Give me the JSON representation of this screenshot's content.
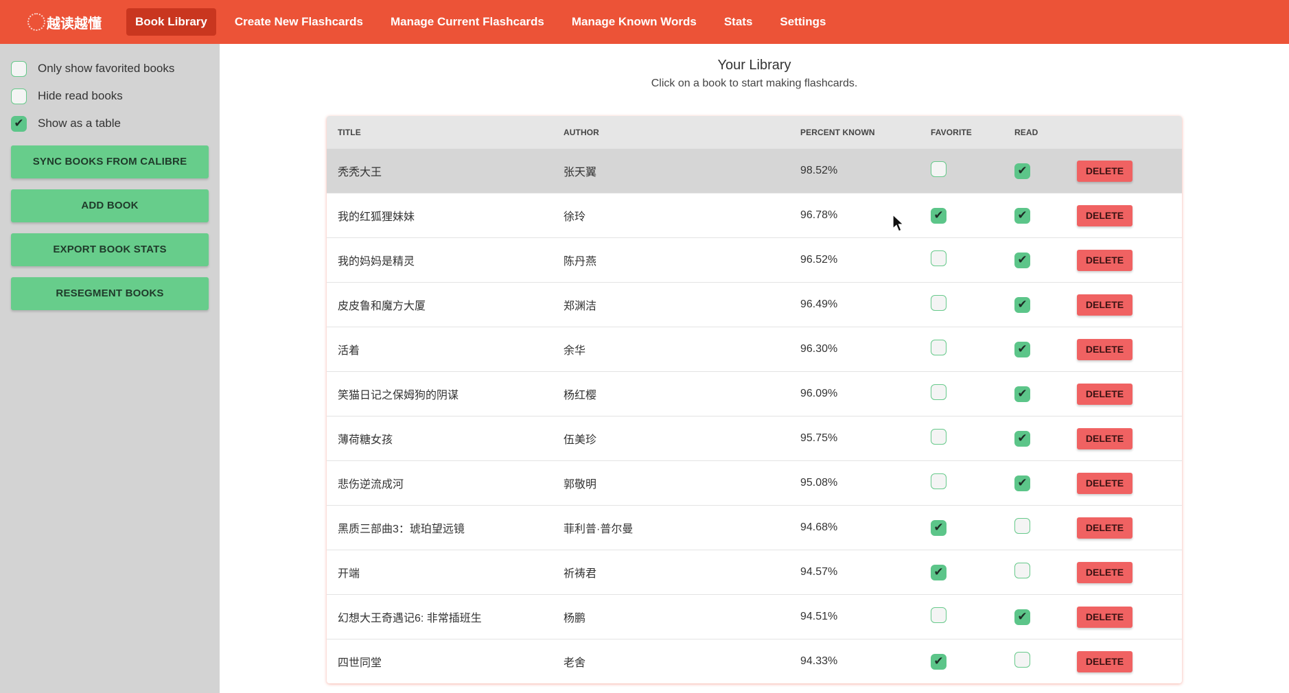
{
  "app": {
    "brand_name": "越读越懂",
    "accent_color": "#ec5337",
    "success_color": "#67cd8b",
    "danger_color": "#f06262"
  },
  "nav": {
    "items": [
      {
        "label": "Book Library",
        "active": true
      },
      {
        "label": "Create New Flashcards",
        "active": false
      },
      {
        "label": "Manage Current Flashcards",
        "active": false
      },
      {
        "label": "Manage Known Words",
        "active": false
      },
      {
        "label": "Stats",
        "active": false
      },
      {
        "label": "Settings",
        "active": false
      }
    ]
  },
  "sidebar": {
    "filters": [
      {
        "label": "Only show favorited books",
        "checked": false
      },
      {
        "label": "Hide read books",
        "checked": false
      },
      {
        "label": "Show as a table",
        "checked": true
      }
    ],
    "buttons": [
      {
        "label": "SYNC BOOKS FROM CALIBRE"
      },
      {
        "label": "ADD BOOK"
      },
      {
        "label": "EXPORT BOOK STATS"
      },
      {
        "label": "RESEGMENT BOOKS"
      }
    ]
  },
  "main": {
    "title": "Your Library",
    "subtitle": "Click on a book to start making flashcards."
  },
  "table": {
    "headers": {
      "title": "TITLE",
      "author": "AUTHOR",
      "percent_known": "PERCENT KNOWN",
      "favorite": "FAVORITE",
      "read": "READ"
    },
    "delete_label": "DELETE",
    "rows": [
      {
        "title": "秃秃大王",
        "author": "张天翼",
        "percent": "98.52%",
        "favorite": false,
        "read": true,
        "hover": true
      },
      {
        "title": "我的红狐狸妹妹",
        "author": "徐玲",
        "percent": "96.78%",
        "favorite": true,
        "read": true
      },
      {
        "title": "我的妈妈是精灵",
        "author": "陈丹燕",
        "percent": "96.52%",
        "favorite": false,
        "read": true
      },
      {
        "title": "皮皮鲁和魔方大厦",
        "author": "郑渊洁",
        "percent": "96.49%",
        "favorite": false,
        "read": true
      },
      {
        "title": "活着",
        "author": "余华",
        "percent": "96.30%",
        "favorite": false,
        "read": true
      },
      {
        "title": "笑猫日记之保姆狗的阴谋",
        "author": "杨红樱",
        "percent": "96.09%",
        "favorite": false,
        "read": true
      },
      {
        "title": "薄荷糖女孩",
        "author": "伍美珍",
        "percent": "95.75%",
        "favorite": false,
        "read": true
      },
      {
        "title": "悲伤逆流成河",
        "author": "郭敬明",
        "percent": "95.08%",
        "favorite": false,
        "read": true
      },
      {
        "title": "黑质三部曲3：琥珀望远镜",
        "author": "菲利普·普尔曼",
        "percent": "94.68%",
        "favorite": true,
        "read": false
      },
      {
        "title": "开端",
        "author": "祈祷君",
        "percent": "94.57%",
        "favorite": true,
        "read": false
      },
      {
        "title": "幻想大王奇遇记6: 非常插班生",
        "author": "杨鹏",
        "percent": "94.51%",
        "favorite": false,
        "read": true
      },
      {
        "title": "四世同堂",
        "author": "老舍",
        "percent": "94.33%",
        "favorite": true,
        "read": false
      }
    ]
  }
}
